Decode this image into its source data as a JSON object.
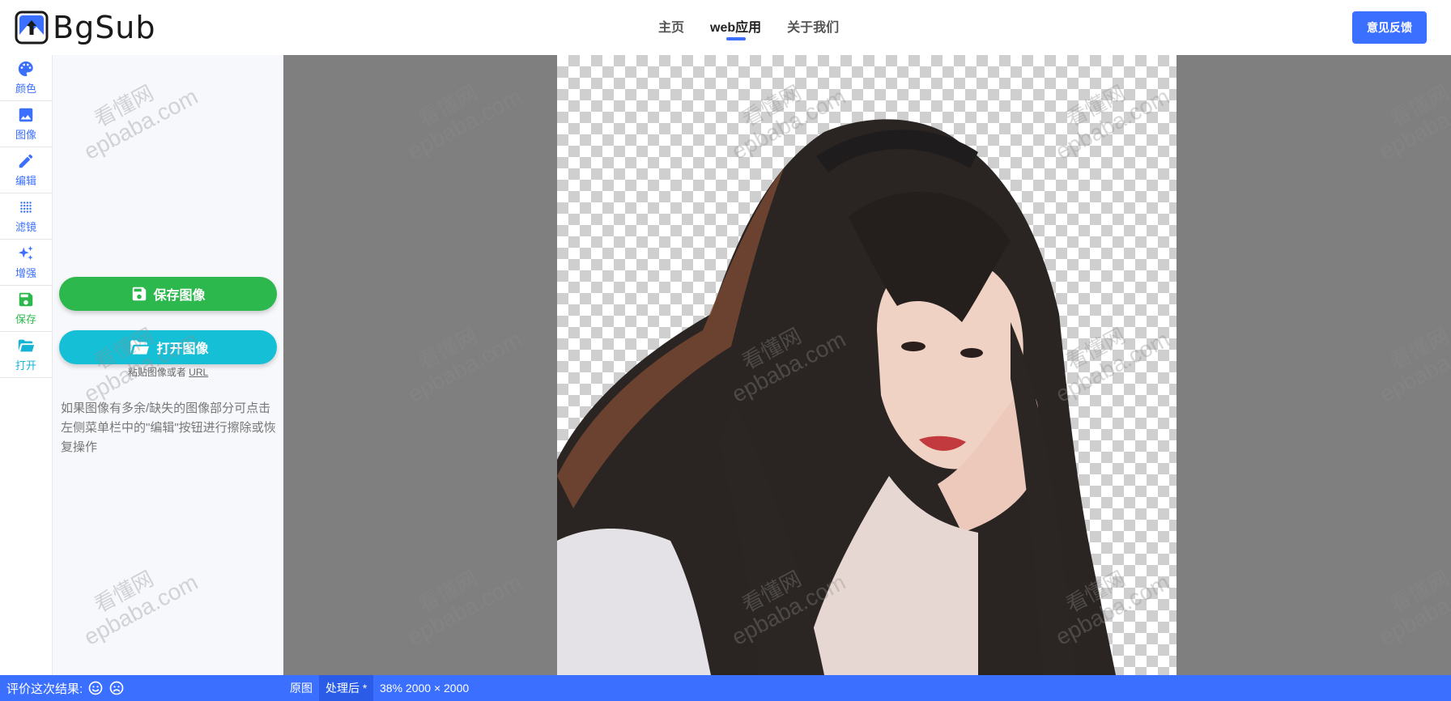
{
  "header": {
    "logo_text": "BgSub",
    "nav": [
      "主页",
      "web应用",
      "关于我们"
    ],
    "active_nav": "web应用",
    "feedback_label": "意见反馈"
  },
  "toolbar": {
    "items": [
      {
        "label": "颜色",
        "icon": "palette-icon"
      },
      {
        "label": "图像",
        "icon": "image-icon"
      },
      {
        "label": "编辑",
        "icon": "pencil-icon"
      },
      {
        "label": "滤镜",
        "icon": "dots-grid-icon"
      },
      {
        "label": "增强",
        "icon": "sparkle-icon"
      },
      {
        "label": "保存",
        "icon": "floppy-icon"
      },
      {
        "label": "打开",
        "icon": "folder-open-icon"
      }
    ]
  },
  "panel": {
    "save_button": "保存图像",
    "open_button": "打开图像",
    "paste_hint": "粘贴图像或者",
    "paste_url": "URL",
    "tip": "如果图像有多余/缺失的图像部分可点击左侧菜单栏中的\"编辑\"按钮进行擦除或恢复操作"
  },
  "watermark": {
    "line1": "看懂网",
    "line2": "epbaba.com"
  },
  "status": {
    "rate_label": "评价这次结果:",
    "tab_original": "原图",
    "tab_processed": "处理后 *",
    "zoom_info": "38% 2000 × 2000"
  },
  "colors": {
    "accent": "#3b6fff",
    "save_green": "#2db84d",
    "open_cyan": "#15c0d6",
    "canvas_gray": "#7f7f7f"
  }
}
